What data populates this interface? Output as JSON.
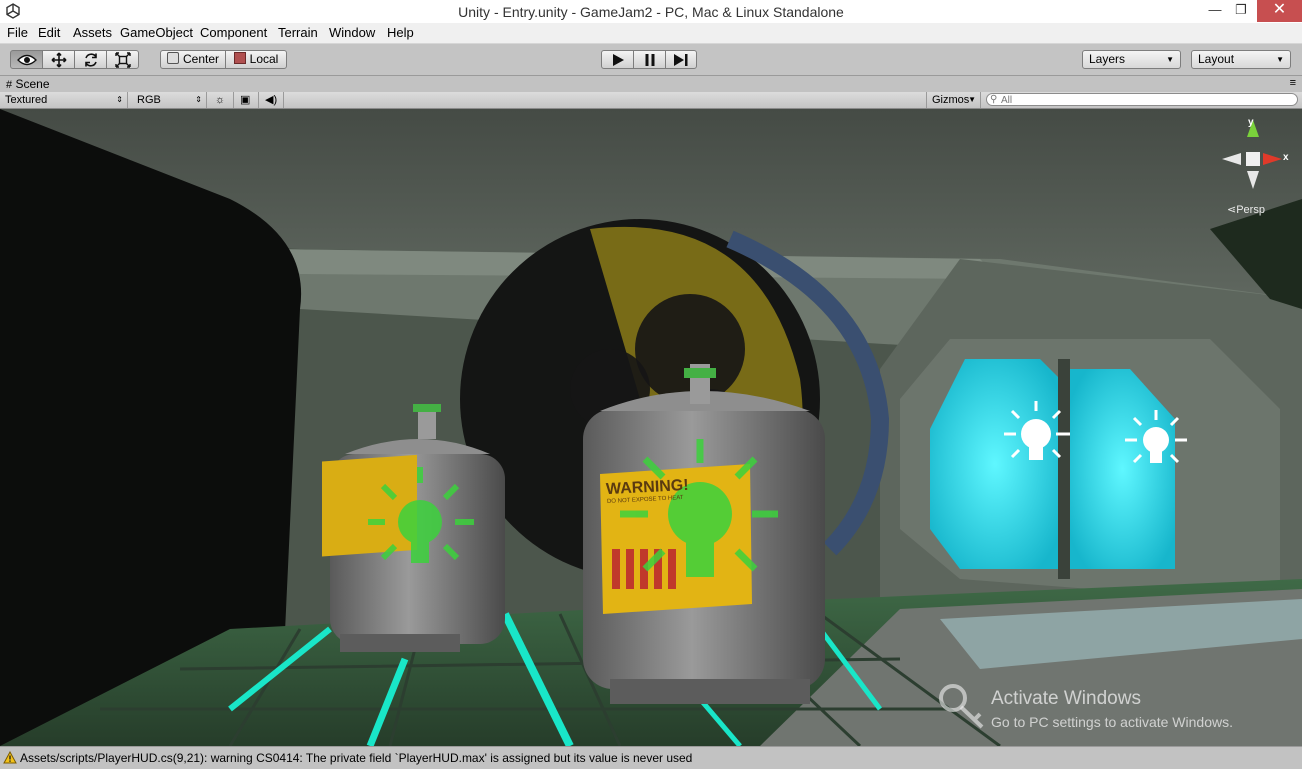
{
  "window": {
    "title": "Unity - Entry.unity - GameJam2 - PC, Mac & Linux Standalone",
    "minimize": "—",
    "restore": "❐",
    "close": "✕"
  },
  "menu": [
    "File",
    "Edit",
    "Assets",
    "GameObject",
    "Component",
    "Terrain",
    "Window",
    "Help"
  ],
  "toolbar": {
    "pivot_label": "Center",
    "space_label": "Local",
    "layers_label": "Layers",
    "layout_label": "Layout"
  },
  "scene": {
    "tab_label": "Scene",
    "render_mode": "Textured",
    "color_mode": "RGB",
    "gizmos_label": "Gizmos",
    "search_placeholder": "All",
    "axis_y": "y",
    "axis_x": "x",
    "projection": "Persp",
    "tank_warning": "WARNING!",
    "tank_subtext": "DO NOT EXPOSE TO HEAT"
  },
  "watermark": {
    "title": "Activate Windows",
    "subtitle": "Go to PC settings to activate Windows."
  },
  "status": {
    "message": "Assets/scripts/PlayerHUD.cs(9,21): warning CS0414: The private field `PlayerHUD.max' is assigned but its value is never used"
  },
  "colors": {
    "accent_teal": "#19e6c8",
    "window_glow": "#2fe0f0",
    "gizmo_light": "#3cd23c",
    "warning_panel": "#e2b414",
    "close_red": "#c74f50"
  }
}
